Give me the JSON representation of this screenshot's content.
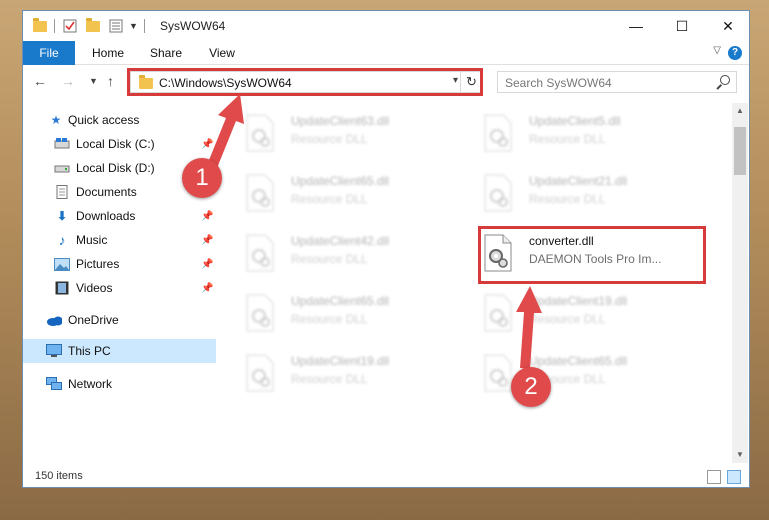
{
  "window": {
    "title": "SysWOW64",
    "controls": {
      "minimize": "—",
      "maximize": "☐",
      "close": "✕"
    }
  },
  "ribbon": {
    "tabs": [
      "File",
      "Home",
      "Share",
      "View"
    ],
    "help": "?"
  },
  "navigation": {
    "address": "C:\\Windows\\SysWOW64",
    "search_placeholder": "Search SysWOW64"
  },
  "sidebar": {
    "items": [
      {
        "label": "Quick access",
        "icon": "star-icon",
        "pinned": false
      },
      {
        "label": "Local Disk (C:)",
        "icon": "drive-icon",
        "pinned": true
      },
      {
        "label": "Local Disk (D:)",
        "icon": "drive-icon",
        "pinned": false
      },
      {
        "label": "Documents",
        "icon": "documents-icon",
        "pinned": true
      },
      {
        "label": "Downloads",
        "icon": "downloads-icon",
        "pinned": true
      },
      {
        "label": "Music",
        "icon": "music-icon",
        "pinned": true
      },
      {
        "label": "Pictures",
        "icon": "pictures-icon",
        "pinned": true
      },
      {
        "label": "Videos",
        "icon": "videos-icon",
        "pinned": true
      },
      {
        "label": "OneDrive",
        "icon": "onedrive-icon",
        "pinned": false
      },
      {
        "label": "This PC",
        "icon": "pc-icon",
        "pinned": false,
        "selected": true
      },
      {
        "label": "Network",
        "icon": "network-icon",
        "pinned": false
      }
    ]
  },
  "files": [
    {
      "name": "UpdateClient63.dll",
      "desc": "Resource DLL",
      "blurred": true
    },
    {
      "name": "UpdateClient5.dll",
      "desc": "Resource DLL",
      "blurred": true
    },
    {
      "name": "UpdateClient65.dll",
      "desc": "Resource DLL",
      "blurred": true
    },
    {
      "name": "UpdateClient21.dll",
      "desc": "Resource DLL",
      "blurred": true
    },
    {
      "name": "UpdateClient42.dll",
      "desc": "Resource DLL",
      "blurred": true
    },
    {
      "name": "converter.dll",
      "desc": "DAEMON Tools Pro Im...",
      "blurred": false
    },
    {
      "name": "UpdateClient65.dll",
      "desc": "Resource DLL",
      "blurred": true
    },
    {
      "name": "UpdateClient19.dll",
      "desc": "Resource DLL",
      "blurred": true
    },
    {
      "name": "UpdateClient19.dll",
      "desc": "Resource DLL",
      "blurred": true
    },
    {
      "name": "UpdateClient65.dll",
      "desc": "Resource DLL",
      "blurred": true
    }
  ],
  "status": {
    "item_count": "150 items"
  },
  "annotations": {
    "marker1": "1",
    "marker2": "2",
    "color": "#d73a3a"
  }
}
